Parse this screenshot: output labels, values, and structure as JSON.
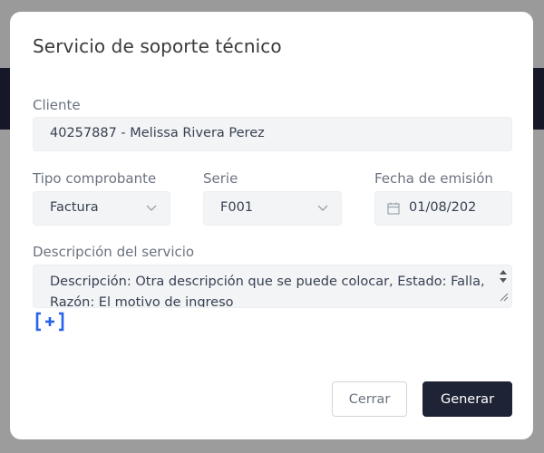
{
  "dialog": {
    "title": "Servicio de soporte técnico"
  },
  "form": {
    "cliente": {
      "label": "Cliente",
      "value": "40257887 - Melissa Rivera Perez"
    },
    "tipo_comprobante": {
      "label": "Tipo comprobante",
      "value": "Factura"
    },
    "serie": {
      "label": "Serie",
      "value": "F001"
    },
    "fecha_emision": {
      "label": "Fecha de emisión",
      "value": "01/08/202"
    },
    "descripcion": {
      "label": "Descripción del servicio",
      "value": "Descripción: Otra descripción que se puede colocar, Estado: Falla, Razón: El motivo de ingreso"
    },
    "add_button": {
      "label": "[+]"
    }
  },
  "actions": {
    "cancel_label": "Cerrar",
    "submit_label": "Generar"
  },
  "colors": {
    "primary_button": "#1e2335",
    "accent": "#2563eb",
    "backdrop": "#9a9a9a"
  }
}
